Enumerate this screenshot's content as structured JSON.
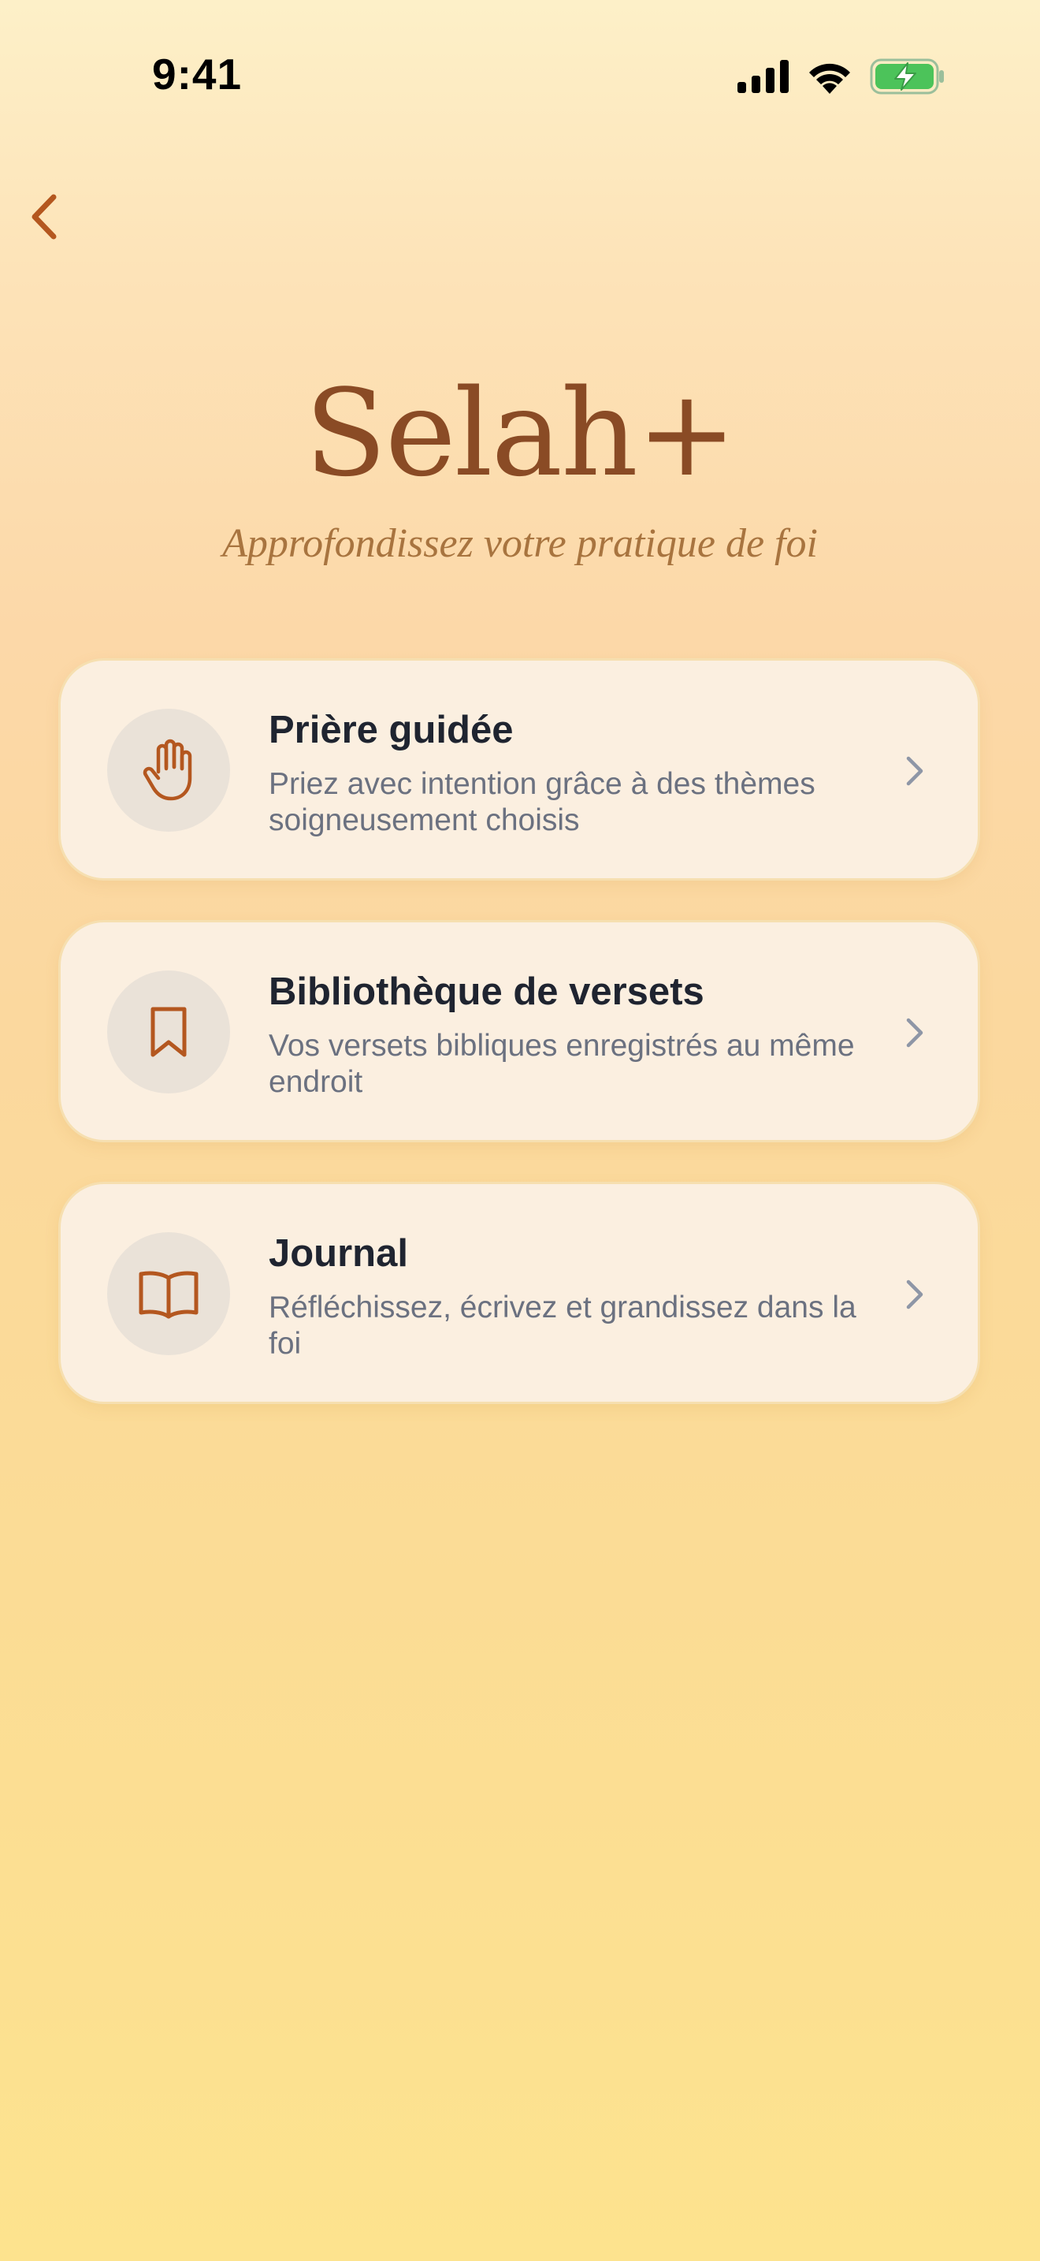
{
  "status_bar": {
    "time": "9:41"
  },
  "header": {
    "back_icon": "chevron-left-icon"
  },
  "hero": {
    "title": "Selah+",
    "subtitle": "Approfondissez votre pratique de foi"
  },
  "cards": [
    {
      "title": "Prière guidée",
      "description": "Priez avec intention grâce à des thèmes soigneusement choisis",
      "icon": "raised-hand-icon"
    },
    {
      "title": "Bibliothèque de versets",
      "description": "Vos versets bibliques enregistrés au même endroit",
      "icon": "bookmark-icon"
    },
    {
      "title": "Journal",
      "description": "Réfléchissez, écrivez et grandissez dans la foi",
      "icon": "open-book-icon"
    }
  ],
  "colors": {
    "accent": "#b4571f",
    "title": "#8a4b25",
    "subtitle": "#a8743f",
    "card_bg": "#fbefe0",
    "icon_circle": "#eae2d8",
    "chevron": "#8e96a6",
    "battery_green": "#4cc35a"
  }
}
